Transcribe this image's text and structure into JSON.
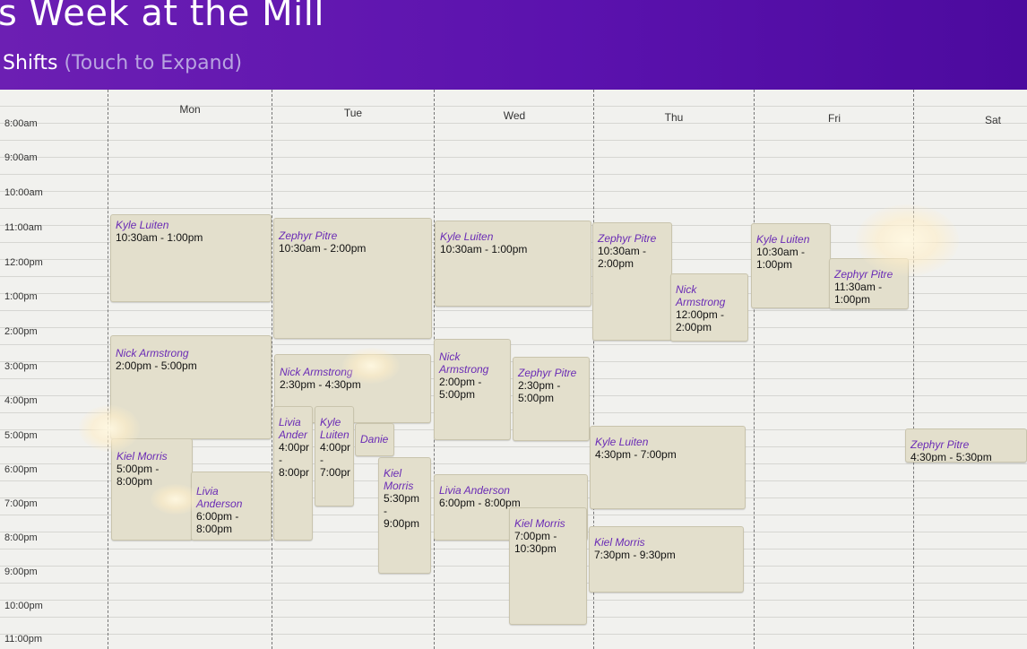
{
  "header": {
    "title": "s Week at the Mill",
    "subtitle_main": "Shifts",
    "subtitle_hint": "(Touch to Expand)"
  },
  "hours": [
    "8:00am",
    "9:00am",
    "10:00am",
    "11:00am",
    "12:00pm",
    "1:00pm",
    "2:00pm",
    "3:00pm",
    "4:00pm",
    "5:00pm",
    "6:00pm",
    "7:00pm",
    "8:00pm",
    "9:00pm",
    "10:00pm",
    "11:00pm"
  ],
  "days": [
    "Mon",
    "Tue",
    "Wed",
    "Thu",
    "Fri",
    "Sat"
  ],
  "shifts": [
    {
      "name": "Kyle Luiten",
      "time": "10:30am - 1:00pm"
    },
    {
      "name": "Nick Armstrong",
      "time": "2:00pm - 5:00pm"
    },
    {
      "name": "Kiel Morris",
      "time": "5:00pm - 8:00pm"
    },
    {
      "name": "Livia Anderson",
      "time": "6:00pm - 8:00pm"
    },
    {
      "name": "Zephyr Pitre",
      "time": "10:30am - 2:00pm"
    },
    {
      "name": "Nick Armstrong",
      "time": "2:30pm - 4:30pm"
    },
    {
      "name": "Livia Ander",
      "time": "4:00pr - 8:00pr"
    },
    {
      "name": "Kyle Luiten",
      "time": "4:00pr - 7:00pr"
    },
    {
      "name": "Danie",
      "time": ""
    },
    {
      "name": "Kiel Morris",
      "time": "5:30pm - 9:00pm"
    },
    {
      "name": "Kyle Luiten",
      "time": "10:30am - 1:00pm"
    },
    {
      "name": "Nick Armstrong",
      "time": "2:00pm - 5:00pm"
    },
    {
      "name": "Zephyr Pitre",
      "time": "2:30pm - 5:00pm"
    },
    {
      "name": "Livia Anderson",
      "time": "6:00pm - 8:00pm"
    },
    {
      "name": "Kiel Morris",
      "time": "7:00pm - 10:30pm"
    },
    {
      "name": "Zephyr Pitre",
      "time": "10:30am - 2:00pm"
    },
    {
      "name": "Nick Armstrong",
      "time": "12:00pm - 2:00pm"
    },
    {
      "name": "Kyle Luiten",
      "time": "4:30pm - 7:00pm"
    },
    {
      "name": "Kiel Morris",
      "time": "7:30pm - 9:30pm"
    },
    {
      "name": "Kyle Luiten",
      "time": "10:30am - 1:00pm"
    },
    {
      "name": "Zephyr Pitre",
      "time": "11:30am - 1:00pm"
    },
    {
      "name": "Zephyr Pitre",
      "time": "4:30pm - 5:30pm"
    }
  ],
  "colors": {
    "header_purple": "#5b12ae",
    "shift_fill": "#e3dfcc",
    "name_purple": "#6a2bb5"
  }
}
